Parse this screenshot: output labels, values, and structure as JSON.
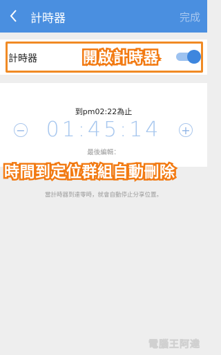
{
  "appbar": {
    "title": "計時器",
    "done_label": "完成"
  },
  "timer_toggle": {
    "label": "計時器",
    "state": "on"
  },
  "annotations": {
    "enable_timer": "開啟計時器",
    "auto_delete": "時間到定位群組自動刪除"
  },
  "countdown": {
    "until_text": "到pm02:22為止",
    "time": "01:45:14",
    "minus_label": "−",
    "plus_label": "+",
    "last_edited": "最後編輯："
  },
  "info_text": "當計時器到達零時，就會自動停止分享位置。",
  "watermark": "電腦王阿達",
  "colors": {
    "appbar": "#4a8fe0",
    "accent": "#3e86de",
    "annotation": "#f27a12"
  }
}
